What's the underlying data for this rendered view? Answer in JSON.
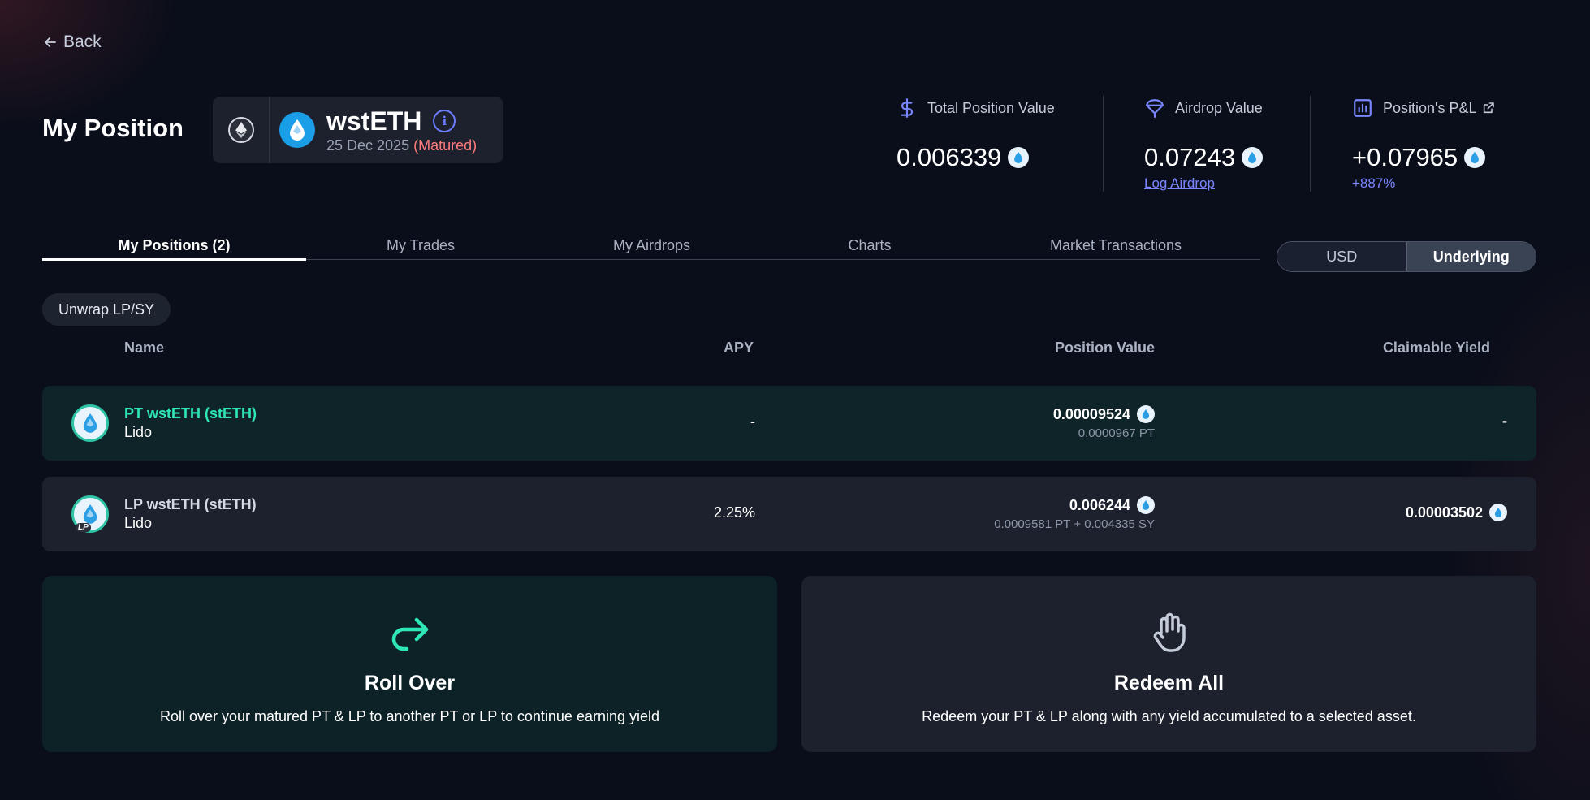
{
  "nav": {
    "back_label": "Back"
  },
  "page_title": "My Position",
  "market": {
    "chain_icon": "ethereum-icon",
    "asset_icon": "wsteth-drop-icon",
    "name": "wstETH",
    "date": "25 Dec 2025",
    "status": "(Matured)"
  },
  "stats": {
    "total": {
      "label": "Total Position Value",
      "value": "0.006339",
      "icon": "dollar-icon"
    },
    "airdrop": {
      "label": "Airdrop Value",
      "value": "0.07243",
      "link": "Log Airdrop",
      "icon": "parachute-icon"
    },
    "pnl": {
      "label": "Position's P&L",
      "value": "+0.07965",
      "change": "+887%",
      "icon": "bar-chart-icon"
    }
  },
  "tabs": [
    {
      "label": "My Positions (2)",
      "active": true
    },
    {
      "label": "My Trades"
    },
    {
      "label": "My Airdrops"
    },
    {
      "label": "Charts"
    },
    {
      "label": "Market Transactions"
    }
  ],
  "currency_toggle": {
    "usd": "USD",
    "underlying": "Underlying",
    "selected": "Underlying"
  },
  "unwrap_label": "Unwrap LP/SY",
  "table": {
    "headers": {
      "name": "Name",
      "apy": "APY",
      "value": "Position Value",
      "yield": "Claimable Yield"
    },
    "rows": [
      {
        "name": "PT wstETH (stETH)",
        "protocol": "Lido",
        "apy": "-",
        "value": "0.00009524",
        "value_sub": "0.0000967 PT",
        "yield": "-"
      },
      {
        "name": "LP wstETH (stETH)",
        "protocol": "Lido",
        "apy": "2.25%",
        "value": "0.006244",
        "value_sub": "0.0009581 PT + 0.004335 SY",
        "yield": "0.00003502",
        "badge": "LP"
      }
    ]
  },
  "actions": {
    "rollover": {
      "title": "Roll Over",
      "desc": "Roll over your matured PT & LP to another PT or LP to continue earning yield"
    },
    "redeem": {
      "title": "Redeem All",
      "desc": "Redeem your PT & LP along with any yield accumulated to a selected asset."
    }
  },
  "colors": {
    "accent": "#6b7cff",
    "pt_green": "#2ee6b6",
    "matured_red": "#ff7b7b",
    "bg": "#0a0e1a"
  }
}
